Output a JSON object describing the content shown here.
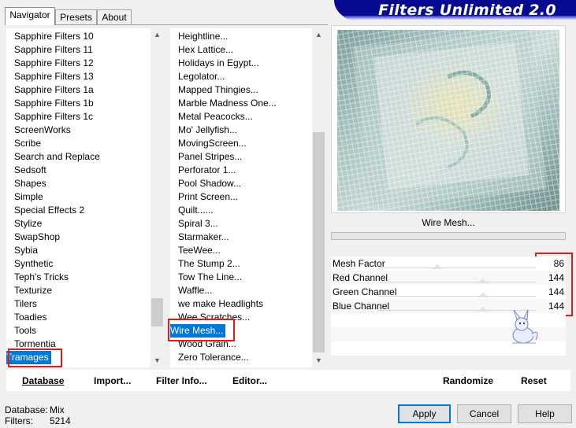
{
  "tabs": [
    "Navigator",
    "Presets",
    "About"
  ],
  "banner": "Filters Unlimited 2.0",
  "categories": [
    "Sapphire Filters 10",
    "Sapphire Filters 11",
    "Sapphire Filters 12",
    "Sapphire Filters 13",
    "Sapphire Filters 1a",
    "Sapphire Filters 1b",
    "Sapphire Filters 1c",
    "ScreenWorks",
    "Scribe",
    "Search and Replace",
    "Sedsoft",
    "Shapes",
    "Simple",
    "Special Effects 2",
    "Stylize",
    "SwapShop",
    "Sybia",
    "Synthetic",
    "Teph's Tricks",
    "Texturize",
    "Tilers",
    "Toadies",
    "Tools",
    "Tormentia",
    "Tramages"
  ],
  "filters": [
    "Heightline...",
    "Hex Lattice...",
    "Holidays in Egypt...",
    "Legolator...",
    "Mapped Thingies...",
    "Marble Madness One...",
    "Metal Peacocks...",
    "Mo' Jellyfish...",
    "MovingScreen...",
    "Panel Stripes...",
    "Perforator 1...",
    "Pool Shadow...",
    "Print Screen...",
    "Quilt......",
    "Spiral 3...",
    "Starmaker...",
    "TeeWee...",
    "The Stump 2...",
    "Tow The Line...",
    "Waffle...",
    "we make Headlights",
    "Wee Scratches...",
    "Wire Mesh...",
    "Wood Grain...",
    "Zero Tolerance..."
  ],
  "selected_category": "Tramages",
  "selected_filter": "Wire Mesh...",
  "preview_title": "Wire Mesh...",
  "params": [
    {
      "label": "Mesh Factor",
      "value": "86",
      "level": 0.34
    },
    {
      "label": "Red Channel",
      "value": "144",
      "level": 0.56
    },
    {
      "label": "Green Channel",
      "value": "144",
      "level": 0.56
    },
    {
      "label": "Blue Channel",
      "value": "144",
      "level": 0.56
    }
  ],
  "bottom_buttons": {
    "database": "Database",
    "import": "Import...",
    "filter_info": "Filter Info...",
    "editor": "Editor...",
    "randomize": "Randomize",
    "reset": "Reset"
  },
  "status": {
    "database_label": "Database:",
    "database_value": "Mix",
    "filters_label": "Filters:",
    "filters_value": "5214"
  },
  "dialog_buttons": {
    "apply": "Apply",
    "cancel": "Cancel",
    "help": "Help"
  },
  "colors": {
    "banner": "#070b90",
    "selection": "#0078d7",
    "highlight_box": "#e31a1c"
  },
  "icons": {
    "scroll_up": "▲",
    "scroll_down": "▼"
  }
}
